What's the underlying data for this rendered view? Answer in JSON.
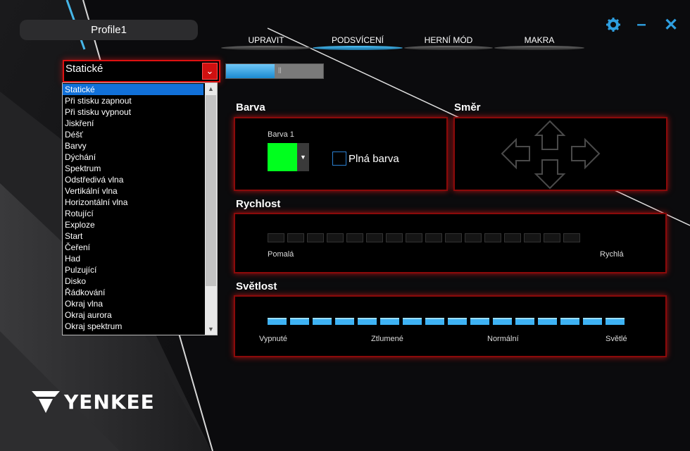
{
  "app": {
    "logo_text": "YENKEE"
  },
  "profile": {
    "name": "Profile1"
  },
  "window_controls": {
    "settings_icon": "gear-icon",
    "minimize_icon": "minimize-icon",
    "close_icon": "close-icon",
    "accent": "#2e9fe0"
  },
  "tabs": [
    {
      "label": "UPRAVIT",
      "active": false
    },
    {
      "label": "PODSVÍCENÍ",
      "active": true
    },
    {
      "label": "HERNÍ MÓD",
      "active": false
    },
    {
      "label": "MAKRA",
      "active": false
    }
  ],
  "effect": {
    "selected": "Statické",
    "options": [
      "Statické",
      "Při stisku zapnout",
      "Při stisku vypnout",
      "Jiskření",
      "Déšť",
      "Barvy",
      "Dýchání",
      "Spektrum",
      "Odstředivá vlna",
      "Vertikální vlna",
      "Horizontální vlna",
      "Rotující",
      "Exploze",
      "Start",
      "Čeření",
      "Had",
      "Pulzující",
      "Disko",
      "Řádkování",
      "Okraj vlna",
      "Okraj aurora",
      "Okraj spektrum"
    ]
  },
  "lighting_toggle": {
    "on_fraction": 0.5
  },
  "color_section": {
    "title": "Barva",
    "color_label": "Barva 1",
    "color_value": "#00ff1e",
    "solid_label": "Plná barva",
    "solid_checked": false
  },
  "direction_section": {
    "title": "Směr",
    "icons": [
      "arrow-up-icon",
      "arrow-down-icon",
      "arrow-left-icon",
      "arrow-right-icon"
    ]
  },
  "speed_section": {
    "title": "Rychlost",
    "min_label": "Pomalá",
    "max_label": "Rychlá",
    "steps": 16,
    "level": 0
  },
  "brightness_section": {
    "title": "Světlost",
    "labels": [
      "Vypnuté",
      "Ztlumené",
      "Normální",
      "Světlé"
    ],
    "steps": 16,
    "level": 16
  },
  "colors": {
    "accent_blue": "#3eb2f4",
    "panel_border_red": "#c81414",
    "dropdown_button_red": "#d01010",
    "selection_blue": "#1170d8"
  }
}
